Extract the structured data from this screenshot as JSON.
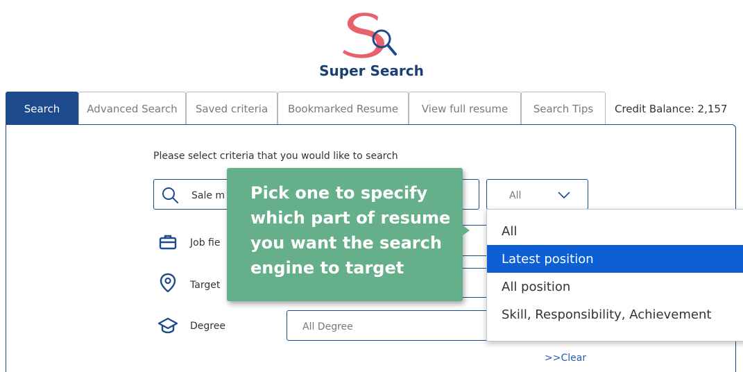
{
  "brand": {
    "logo_name": "super-search-logo",
    "title": "Super Search",
    "colors": {
      "logo_red": "#e8606a",
      "navy": "#1c4a8c"
    }
  },
  "tabs": [
    {
      "label": "Search",
      "active": true
    },
    {
      "label": "Advanced Search",
      "active": false
    },
    {
      "label": "Saved criteria",
      "active": false
    },
    {
      "label": "Bookmarked Resume",
      "active": false
    },
    {
      "label": "View full resume",
      "active": false
    },
    {
      "label": "Search Tips",
      "active": false
    }
  ],
  "credit": {
    "label": "Credit Balance: 2,157"
  },
  "form": {
    "prompt": "Please select criteria that you would like to search",
    "keyword_value": "Sale m",
    "scope_select_value": "All",
    "job_field_label": "Job fie",
    "target_label": "Target",
    "degree_label": "Degree",
    "degree_value": "All Degree",
    "clear_link": ">>Clear"
  },
  "scope_dropdown": {
    "options": [
      "All",
      "Latest position",
      "All position",
      "Skill, Responsibility, Achievement"
    ],
    "highlighted": "Latest position",
    "highlight_color": "#0d5fd6"
  },
  "tooltip": {
    "text": "Pick one to specify which part of resume you want the search engine to target",
    "color": "#65b08a"
  },
  "icons": [
    "search-icon",
    "chevron-down-icon",
    "briefcase-icon",
    "location-pin-icon",
    "graduation-cap-icon",
    "magnifier-logo-icon"
  ]
}
